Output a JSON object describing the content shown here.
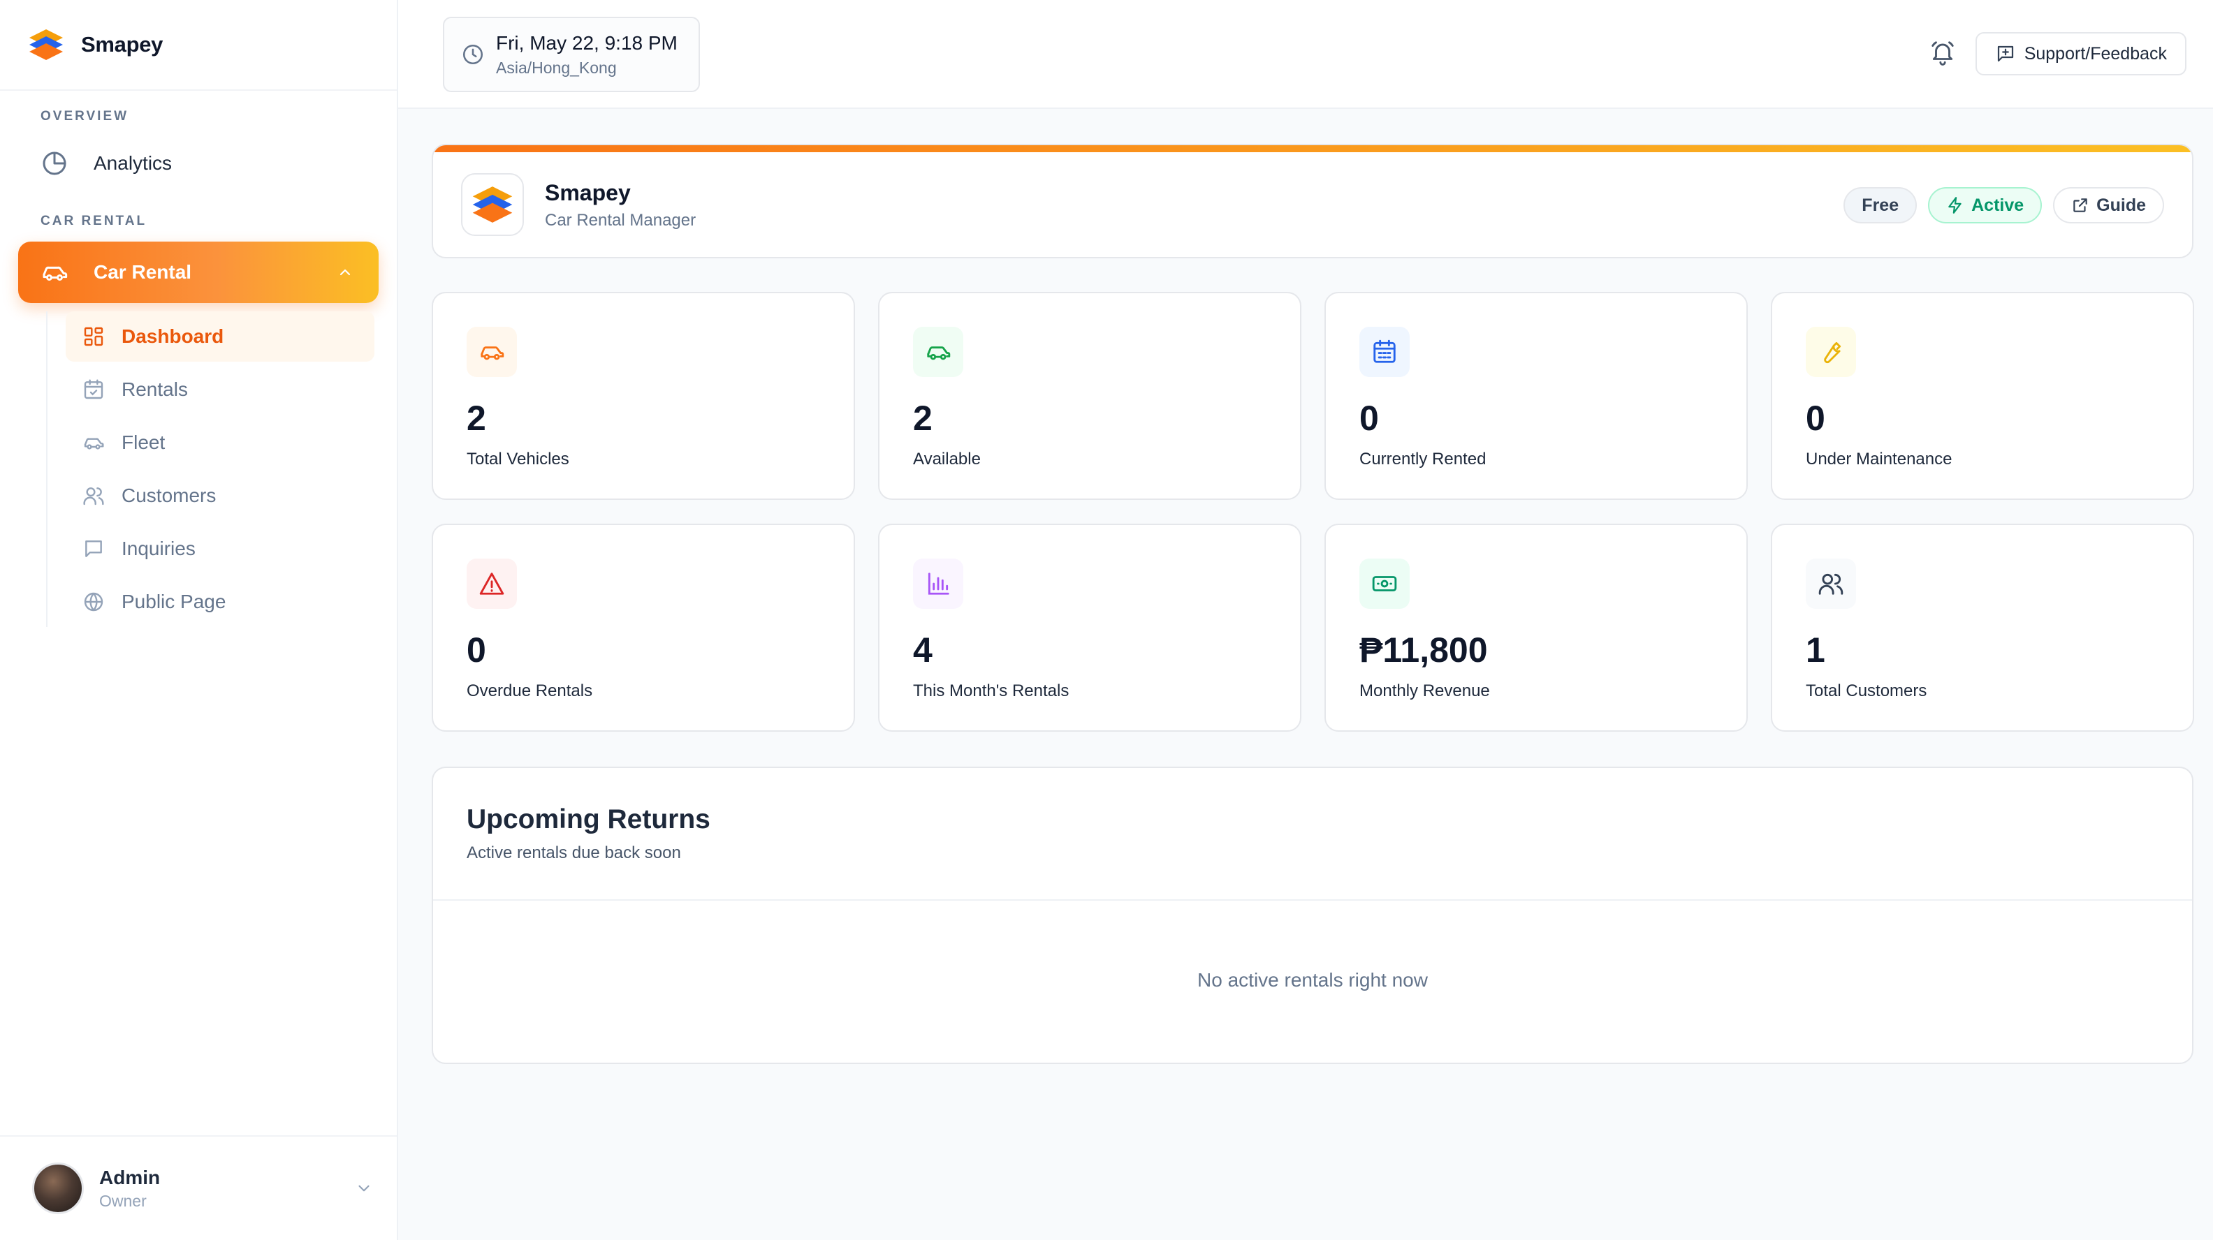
{
  "sidebar": {
    "brand_name": "Smapey",
    "sections": {
      "overview": "OVERVIEW",
      "car_rental": "CAR RENTAL"
    },
    "analytics_label": "Analytics",
    "car_rental_label": "Car Rental",
    "sub_items": [
      {
        "label": "Dashboard",
        "icon": "grid-icon"
      },
      {
        "label": "Rentals",
        "icon": "calendar-icon"
      },
      {
        "label": "Fleet",
        "icon": "car-icon"
      },
      {
        "label": "Customers",
        "icon": "users-icon"
      },
      {
        "label": "Inquiries",
        "icon": "message-icon"
      },
      {
        "label": "Public Page",
        "icon": "globe-icon"
      }
    ],
    "user": {
      "name": "Admin",
      "role": "Owner"
    }
  },
  "topbar": {
    "date_time": "Fri, May 22, 9:18 PM",
    "timezone": "Asia/Hong_Kong",
    "support_label": "Support/Feedback"
  },
  "app": {
    "title": "Smapey",
    "subtitle": "Car Rental Manager",
    "badges": {
      "free": "Free",
      "active": "Active",
      "guide": "Guide"
    }
  },
  "stats": [
    {
      "value": "2",
      "label": "Total Vehicles",
      "icon": "car-icon",
      "color": "#f97316",
      "bg": "#fff7ed"
    },
    {
      "value": "2",
      "label": "Available",
      "icon": "car-icon",
      "color": "#16a34a",
      "bg": "#f0fdf4"
    },
    {
      "value": "0",
      "label": "Currently Rented",
      "icon": "calendar-icon",
      "color": "#2563eb",
      "bg": "#eff6ff"
    },
    {
      "value": "0",
      "label": "Under Maintenance",
      "icon": "wrench-icon",
      "color": "#eab308",
      "bg": "#fefce8"
    },
    {
      "value": "0",
      "label": "Overdue Rentals",
      "icon": "alert-triangle-icon",
      "color": "#dc2626",
      "bg": "#fef2f2"
    },
    {
      "value": "4",
      "label": "This Month's Rentals",
      "icon": "bar-chart-icon",
      "color": "#a855f7",
      "bg": "#faf5ff"
    },
    {
      "value": "₱11,800",
      "label": "Monthly Revenue",
      "icon": "banknote-icon",
      "color": "#059669",
      "bg": "#ecfdf5"
    },
    {
      "value": "1",
      "label": "Total Customers",
      "icon": "users-icon",
      "color": "#334155",
      "bg": "#f8fafc"
    }
  ],
  "returns": {
    "title": "Upcoming Returns",
    "subtitle": "Active rentals due back soon",
    "empty_text": "No active rentals right now"
  }
}
